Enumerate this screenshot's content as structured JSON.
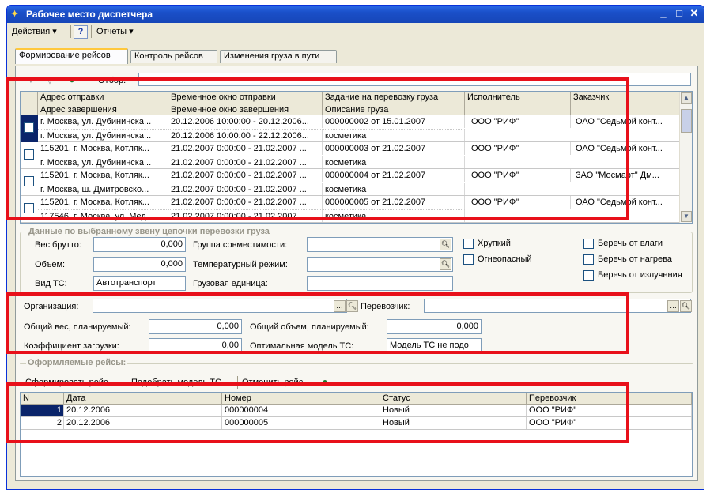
{
  "window": {
    "title": "Рабочее место диспетчера",
    "minimize": "_",
    "maximize": "□",
    "close": "✕"
  },
  "menu": {
    "actions": "Действия ▾",
    "help": "?",
    "reports": "Отчеты ▾"
  },
  "tabs": [
    "Формирование рейсов",
    "Контроль рейсов",
    "Изменения груза в пути"
  ],
  "filter": {
    "label": "Отбор:",
    "value": ""
  },
  "top_grid": {
    "headers_row1": [
      "Адрес отправки",
      "Временное окно отправки",
      "Задание на перевозку груза",
      "Исполнитель",
      "Заказчик"
    ],
    "headers_row2": [
      "Адрес завершения",
      "Временное окно завершения",
      "Описание груза"
    ],
    "rows": [
      {
        "from": "г. Москва, ул. Дубининска...",
        "win_from": "20.12.2006 10:00:00 - 20.12.2006...",
        "task": "000000002 от 15.01.2007",
        "executor": "ООО \"РИФ\"",
        "customer": "ОАО \"Седьмой конт...",
        "to": "г. Москва, ул. Дубининска...",
        "win_to": "20.12.2006 10:00:00 - 22.12.2006...",
        "cargo": "косметика"
      },
      {
        "from": "115201, г. Москва, Котляк...",
        "win_from": "21.02.2007 0:00:00 - 21.02.2007 ...",
        "task": "000000003 от 21.02.2007",
        "executor": "ООО \"РИФ\"",
        "customer": "ОАО \"Седьмой конт...",
        "to": "г. Москва, ул. Дубининска...",
        "win_to": "21.02.2007 0:00:00 - 21.02.2007 ...",
        "cargo": "косметика"
      },
      {
        "from": "115201, г. Москва, Котляк...",
        "win_from": "21.02.2007 0:00:00 - 21.02.2007 ...",
        "task": "000000004 от 21.02.2007",
        "executor": "ООО \"РИФ\"",
        "customer": "ЗАО \"Мосмарт\" Дм...",
        "to": "г. Москва, ш. Дмитровско...",
        "win_to": "21.02.2007 0:00:00 - 21.02.2007 ...",
        "cargo": "косметика"
      },
      {
        "from": "115201, г. Москва, Котляк...",
        "win_from": "21.02.2007 0:00:00 - 21.02.2007 ...",
        "task": "000000005 от 21.02.2007",
        "executor": "ООО \"РИФ\"",
        "customer": "ОАО \"Седьмой конт...",
        "to": "117546, г. Москва, ул. Мед...",
        "win_to": "21.02.2007 0:00:00 - 21.02.2007 ...",
        "cargo": "косметика"
      }
    ]
  },
  "details": {
    "title": "Данные по выбранному звену цепочки перевозки груза",
    "gross_weight_label": "Вес брутто:",
    "gross_weight": "0,000",
    "volume_label": "Объем:",
    "volume": "0,000",
    "vehicle_type_label": "Вид ТС:",
    "vehicle_type": "Автотранспорт",
    "compat_group_label": "Группа совместимости:",
    "compat_group": "",
    "temp_mode_label": "Температурный режим:",
    "temp_mode": "",
    "cargo_unit_label": "Грузовая единица:",
    "cargo_unit": "",
    "fragile": "Хрупкий",
    "flammable": "Огнеопасный",
    "keep_moisture": "Беречь от влаги",
    "keep_heat": "Беречь от нагрева",
    "keep_radiation": "Беречь от излучения"
  },
  "org": {
    "org_label": "Организация:",
    "org_value": "",
    "carrier_label": "Перевозчик:",
    "carrier_value": "",
    "total_weight_label": "Общий вес, планируемый:",
    "total_weight": "0,000",
    "total_volume_label": "Общий объем, планируемый:",
    "total_volume": "0,000",
    "load_factor_label": "Коэффициент загрузки:",
    "load_factor": "0,00",
    "optimal_model_label": "Оптимальная модель ТС:",
    "optimal_model": "Модель ТС не подо"
  },
  "trips": {
    "title": "Оформляемые рейсы:",
    "form_btn": "Сформировать рейс",
    "pick_btn": "Подобрать модель ТС",
    "cancel_btn": "Отменить рейс",
    "headers": [
      "N",
      "Дата",
      "Номер",
      "Статус",
      "Перевозчик"
    ],
    "rows": [
      {
        "n": "1",
        "date": "20.12.2006",
        "number": "000000004",
        "status": "Новый",
        "carrier": "ООО \"РИФ\""
      },
      {
        "n": "2",
        "date": "20.12.2006",
        "number": "000000005",
        "status": "Новый",
        "carrier": "ООО \"РИФ\""
      }
    ]
  },
  "colors": {
    "highlight": "#e8101a",
    "title_bar": "#1a4fc8",
    "selection": "#0a246a"
  }
}
